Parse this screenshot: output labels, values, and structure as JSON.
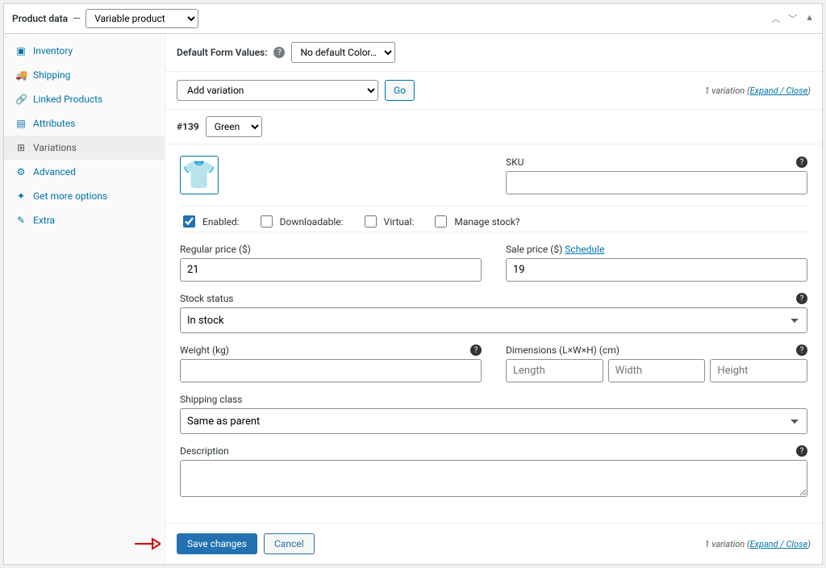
{
  "header": {
    "title": "Product data",
    "dash": "—",
    "product_type": "Variable product",
    "caret_up": "︿",
    "caret_down": "﹀",
    "tri_up": "▲"
  },
  "sidebar": {
    "items": [
      {
        "icon": "▣",
        "label": "Inventory"
      },
      {
        "icon": "🚚",
        "label": "Shipping"
      },
      {
        "icon": "🔗",
        "label": "Linked Products"
      },
      {
        "icon": "▤",
        "label": "Attributes"
      },
      {
        "icon": "⊞",
        "label": "Variations"
      },
      {
        "icon": "⚙",
        "label": "Advanced"
      },
      {
        "icon": "✦",
        "label": "Get more options"
      },
      {
        "icon": "✎",
        "label": "Extra"
      }
    ]
  },
  "top": {
    "default_label": "Default Form Values:",
    "default_select": "No default Color…",
    "add_variation": "Add variation",
    "go": "Go",
    "count_text": "1 variation",
    "expand_close": "Expand / Close",
    "paren_open": "(",
    "paren_close": ")"
  },
  "variation": {
    "id": "#139",
    "color": "Green",
    "thumb_glyph": "👕",
    "thumb_color": "#0b3d2e",
    "checks": {
      "enabled": "Enabled:",
      "downloadable": "Downloadable:",
      "virtual": "Virtual:",
      "manage_stock": "Manage stock?"
    },
    "labels": {
      "sku": "SKU",
      "regular_price": "Regular price ($)",
      "sale_price": "Sale price ($)",
      "schedule": "Schedule",
      "stock_status": "Stock status",
      "weight": "Weight (kg)",
      "dimensions": "Dimensions (L×W×H) (cm)",
      "shipping_class": "Shipping class",
      "description": "Description"
    },
    "values": {
      "sku": "",
      "regular_price": "21",
      "sale_price": "19",
      "stock_status": "In stock",
      "weight": "",
      "length_ph": "Length",
      "width_ph": "Width",
      "height_ph": "Height",
      "shipping_class": "Same as parent",
      "description": ""
    }
  },
  "footer": {
    "save": "Save changes",
    "cancel": "Cancel",
    "count_text": "1 variation",
    "expand_close": "Expand / Close"
  },
  "glyphs": {
    "help": "?"
  }
}
